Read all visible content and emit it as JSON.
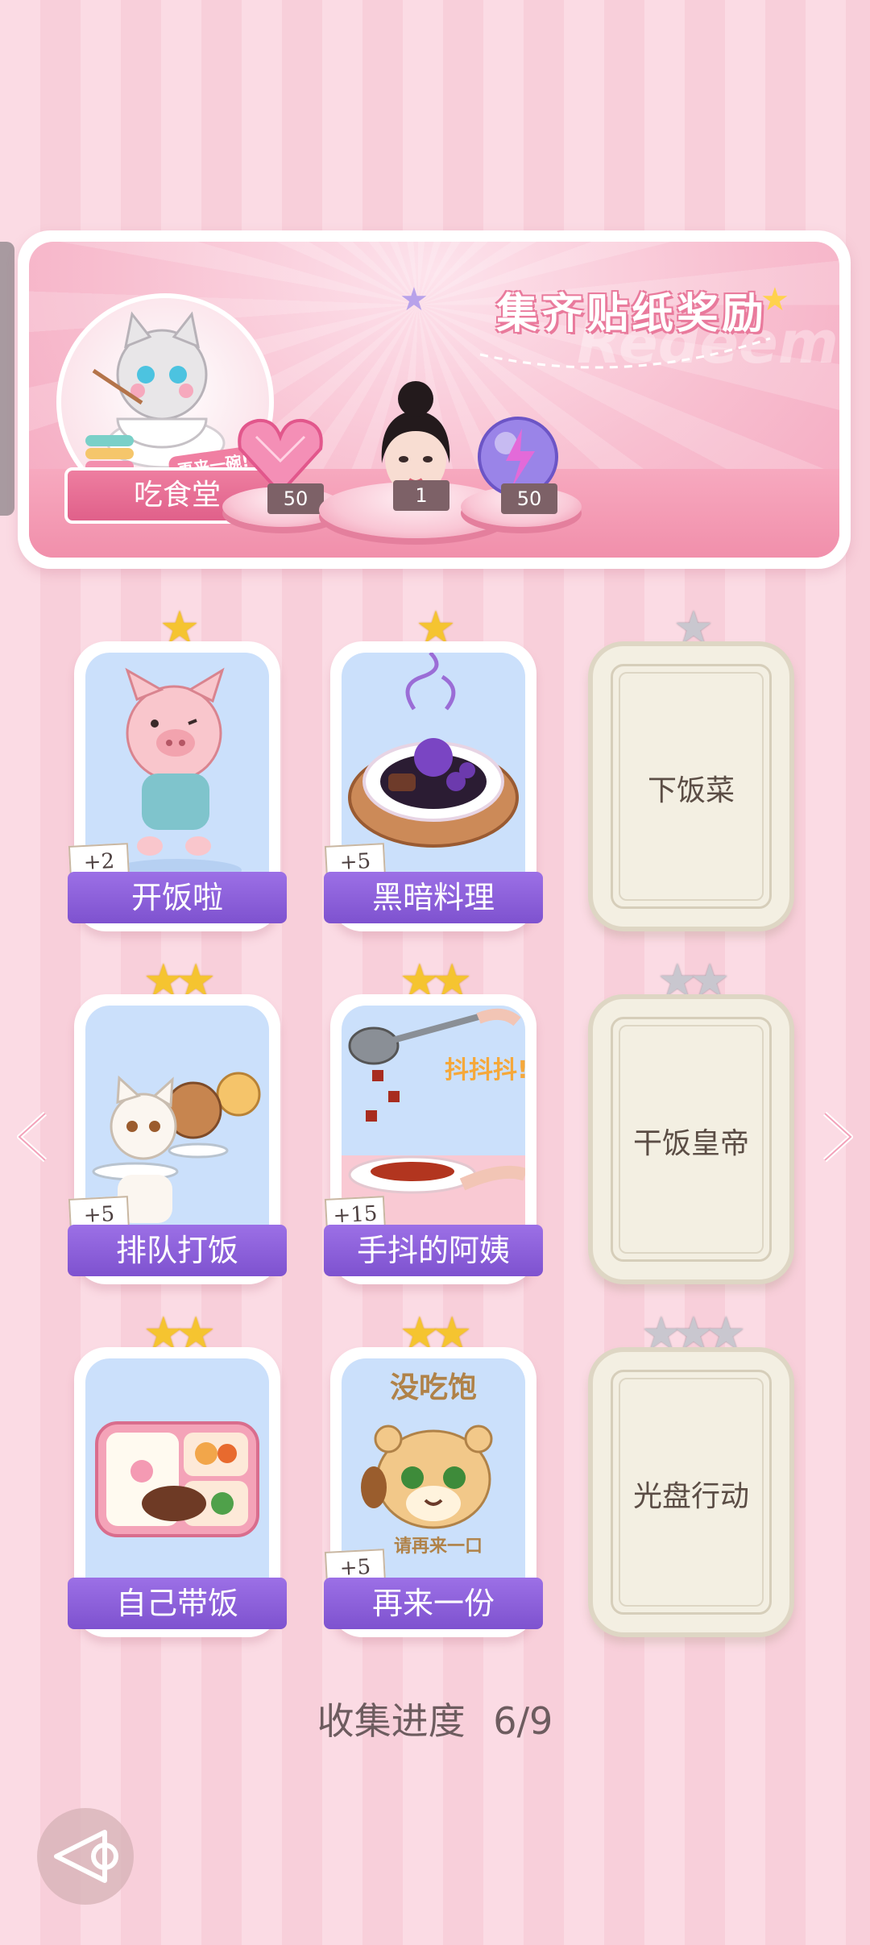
{
  "banner": {
    "title": "集齐贴纸奖励",
    "watermark": "Redeem",
    "shop_name": "吃食堂",
    "shop_tag": "再来一碗!",
    "rewards": [
      {
        "name": "heart-gem",
        "qty": "50"
      },
      {
        "name": "character-portrait",
        "qty": "1"
      },
      {
        "name": "energy-orb",
        "qty": "50"
      }
    ]
  },
  "cards": [
    {
      "label": "开饭啦",
      "bonus": "+2",
      "stars": 1,
      "unlocked": true
    },
    {
      "label": "黑暗料理",
      "bonus": "+5",
      "stars": 1,
      "unlocked": true
    },
    {
      "label": "下饭菜",
      "stars": 1,
      "unlocked": false
    },
    {
      "label": "排队打饭",
      "bonus": "+5",
      "stars": 2,
      "unlocked": true
    },
    {
      "label": "手抖的阿姨",
      "bonus": "+15",
      "stars": 2,
      "unlocked": true,
      "art_text": "抖抖抖!"
    },
    {
      "label": "干饭皇帝",
      "stars": 2,
      "unlocked": false
    },
    {
      "label": "自己带饭",
      "stars": 2,
      "unlocked": true
    },
    {
      "label": "再来一份",
      "bonus": "+5",
      "stars": 2,
      "unlocked": true,
      "art_text_top": "没吃饱",
      "art_text_bottom": "请再来一口"
    },
    {
      "label": "光盘行动",
      "stars": 3,
      "unlocked": false
    }
  ],
  "progress": {
    "label": "收集进度",
    "value": "6/9"
  },
  "colors": {
    "accent": "#8b5cd6",
    "gold_star": "#f5c430",
    "gray_star": "#c9c7cf",
    "pink": "#f48fab"
  }
}
